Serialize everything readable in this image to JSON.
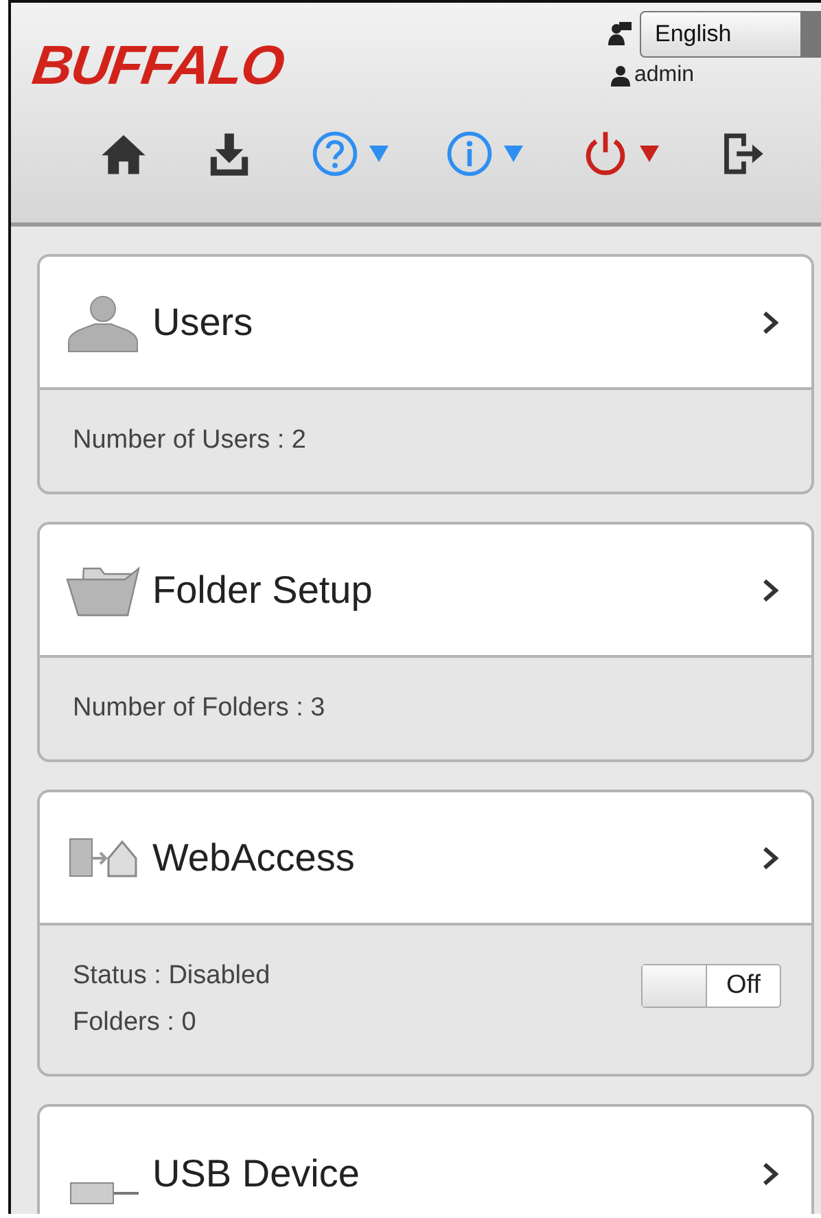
{
  "header": {
    "logo": "BUFFALO",
    "language": "English",
    "user": "admin",
    "toolbar": [
      {
        "kind": "home",
        "dropdown": false
      },
      {
        "kind": "download",
        "dropdown": false
      },
      {
        "kind": "help",
        "dropdown": true
      },
      {
        "kind": "info",
        "dropdown": true
      },
      {
        "kind": "power",
        "dropdown": true
      },
      {
        "kind": "logout",
        "dropdown": false
      }
    ]
  },
  "cards": [
    {
      "kind": "users",
      "title": "Users",
      "lines": [
        "Number of Users : 2"
      ]
    },
    {
      "kind": "folder",
      "title": "Folder Setup",
      "lines": [
        "Number of Folders : 3"
      ]
    },
    {
      "kind": "webaccess",
      "title": "WebAccess",
      "lines": [
        "Status : Disabled",
        "Folders : 0"
      ],
      "toggle": {
        "label": "Off",
        "on": false
      }
    },
    {
      "kind": "usb",
      "title": "USB Device"
    }
  ]
}
